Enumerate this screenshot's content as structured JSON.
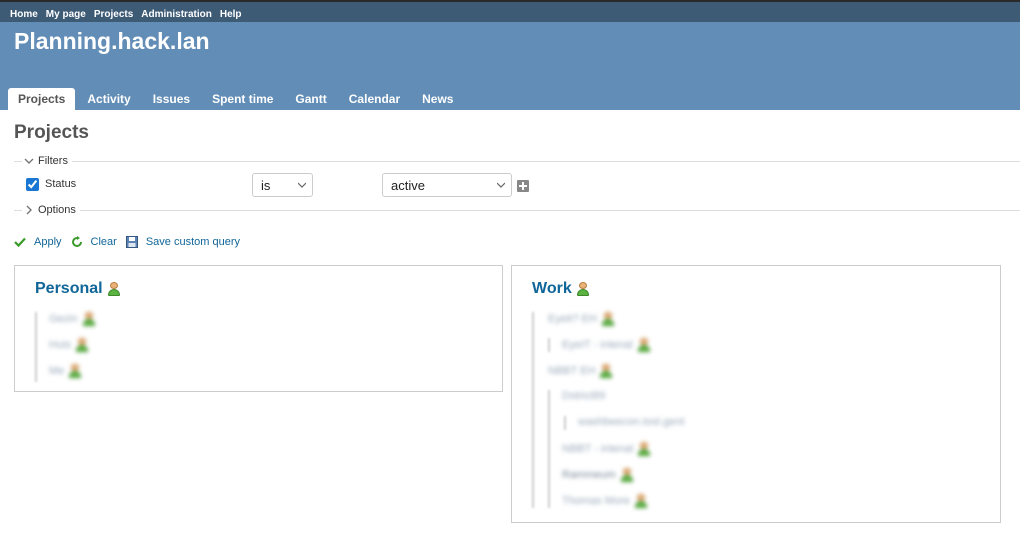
{
  "top_menu": {
    "home": "Home",
    "my_page": "My page",
    "projects": "Projects",
    "administration": "Administration",
    "help": "Help"
  },
  "header": {
    "title": "Planning.hack.lan"
  },
  "main_menu": {
    "projects": "Projects",
    "activity": "Activity",
    "issues": "Issues",
    "spent_time": "Spent time",
    "gantt": "Gantt",
    "calendar": "Calendar",
    "news": "News"
  },
  "page": {
    "title": "Projects"
  },
  "filters": {
    "legend": "Filters",
    "status_label": "Status",
    "status_checked": true,
    "operator": "is",
    "value": "active"
  },
  "options": {
    "legend": "Options"
  },
  "actions": {
    "apply": "Apply",
    "clear": "Clear",
    "save": "Save custom query"
  },
  "projects": {
    "personal": {
      "name": "Personal",
      "children": [
        "Gezin",
        "Huis",
        "Me"
      ]
    },
    "work": {
      "name": "Work",
      "children": [
        "Eyeit? EH",
        "EyeIT - intenal",
        "NBBT EH",
        "Dstrict89",
        "washbeecon.tosl.gent",
        "NBBT - intenal",
        "Rammeum",
        "Thomas More"
      ]
    }
  },
  "colors": {
    "top_menu_bg": "#3e5b76",
    "header_bg": "#628db6",
    "link": "#169"
  }
}
